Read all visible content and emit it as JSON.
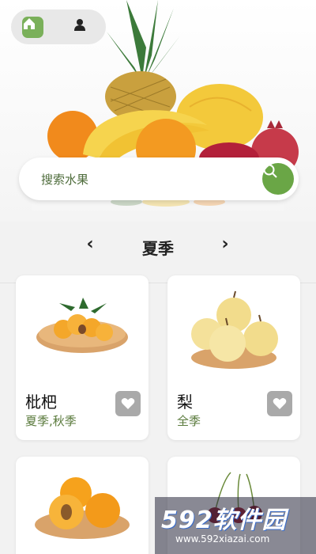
{
  "nav": {
    "home_icon": "home-icon",
    "user_icon": "user-icon"
  },
  "search": {
    "placeholder": "搜索水果",
    "icon": "search-icon"
  },
  "season_selector": {
    "prev_label": "‹",
    "title": "夏季",
    "next_label": "›"
  },
  "fruits": [
    {
      "name": "枇杷",
      "season": "夏季,秋季",
      "favorite_icon": "heart-icon"
    },
    {
      "name": "梨",
      "season": "全季",
      "favorite_icon": "heart-icon"
    },
    {
      "name": "",
      "season": "",
      "favorite_icon": "heart-icon"
    },
    {
      "name": "",
      "season": "",
      "favorite_icon": "heart-icon"
    }
  ],
  "watermark": {
    "logo_text": "592软件园",
    "url": "www.592xiazai.com"
  },
  "colors": {
    "accent_green": "#6aa646",
    "season_text": "#5a7a3c",
    "fav_gray": "#a9a9a9"
  }
}
